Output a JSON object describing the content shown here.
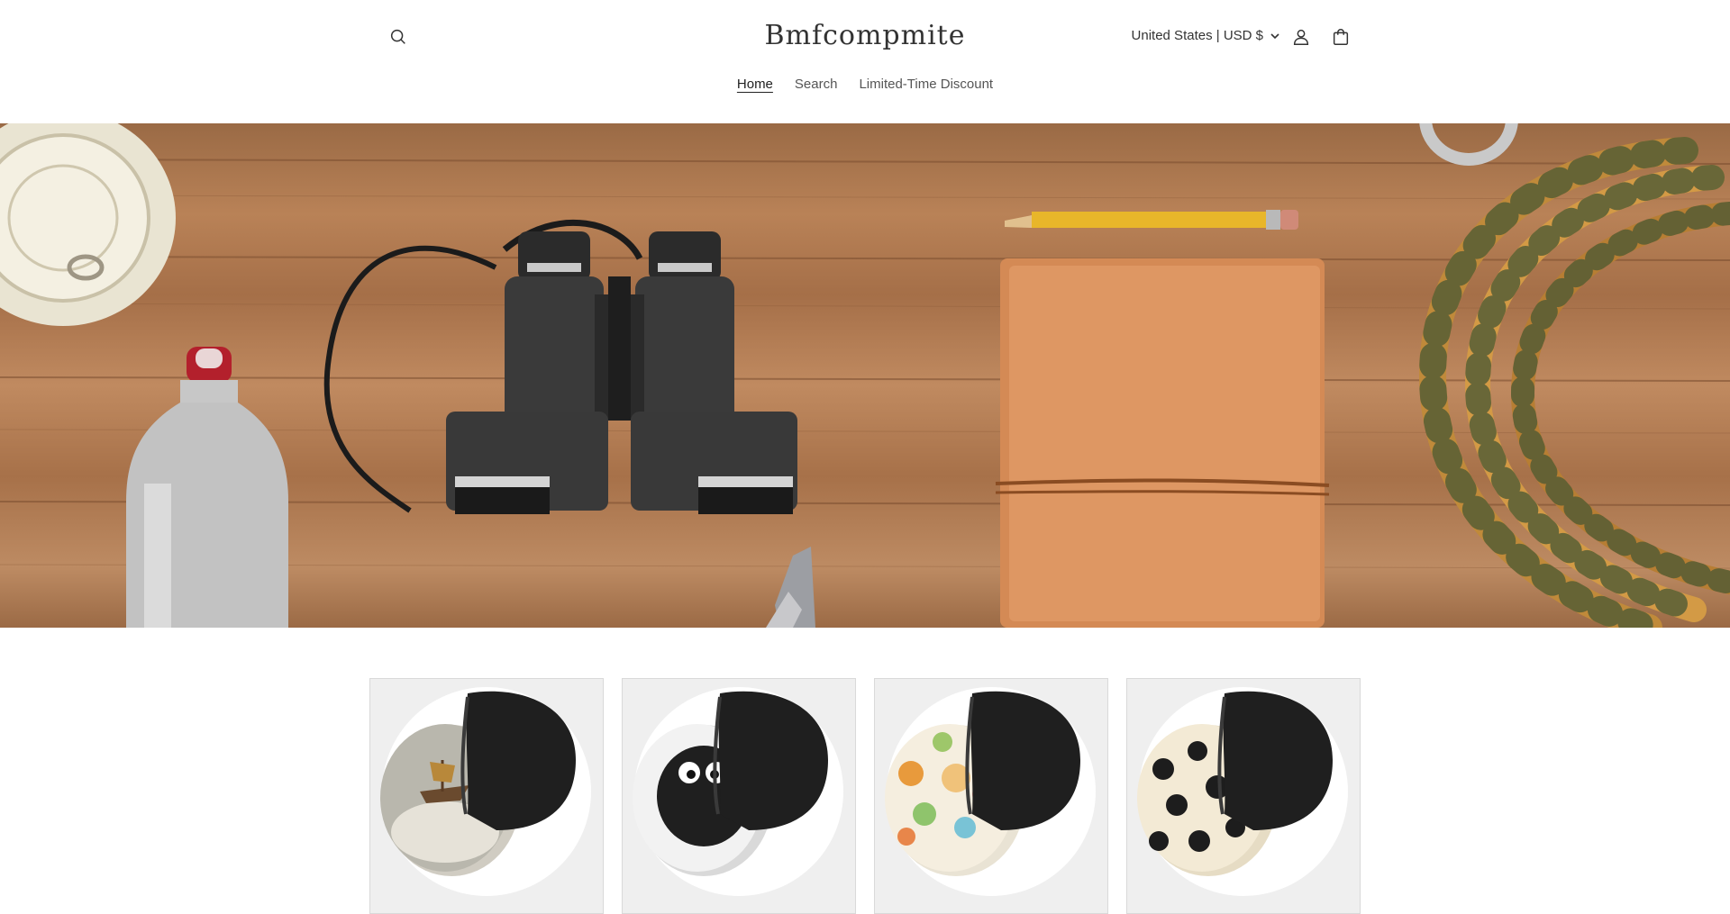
{
  "store": {
    "name": "Bmfcompmite"
  },
  "header": {
    "country_selector": "United States | USD $",
    "icons": {
      "search": "search-icon",
      "account": "account-icon",
      "cart": "cart-icon",
      "chevron": "chevron-down-icon"
    }
  },
  "nav": {
    "items": [
      {
        "label": "Home",
        "active": true
      },
      {
        "label": "Search",
        "active": false
      },
      {
        "label": "Limited-Time Discount",
        "active": false
      }
    ]
  },
  "hero": {
    "image": "hero-banner-outdoor-gear",
    "depicts": [
      "ring-pull tin can",
      "water bottle",
      "binoculars",
      "pocket knife",
      "pencil",
      "leather notebook",
      "climbing rope",
      "carabiner"
    ]
  },
  "products": [
    {
      "image": "coaster-set-flying-ship"
    },
    {
      "image": "coaster-set-black-fuzzy-monster"
    },
    {
      "image": "coaster-set-kawaii-doodles"
    },
    {
      "image": "coaster-set-cute-spiders"
    }
  ],
  "colors": {
    "text": "#121212",
    "card_bg": "#efefef",
    "wood": "#b07a52",
    "coaster_holder": "#1c1c1c"
  }
}
